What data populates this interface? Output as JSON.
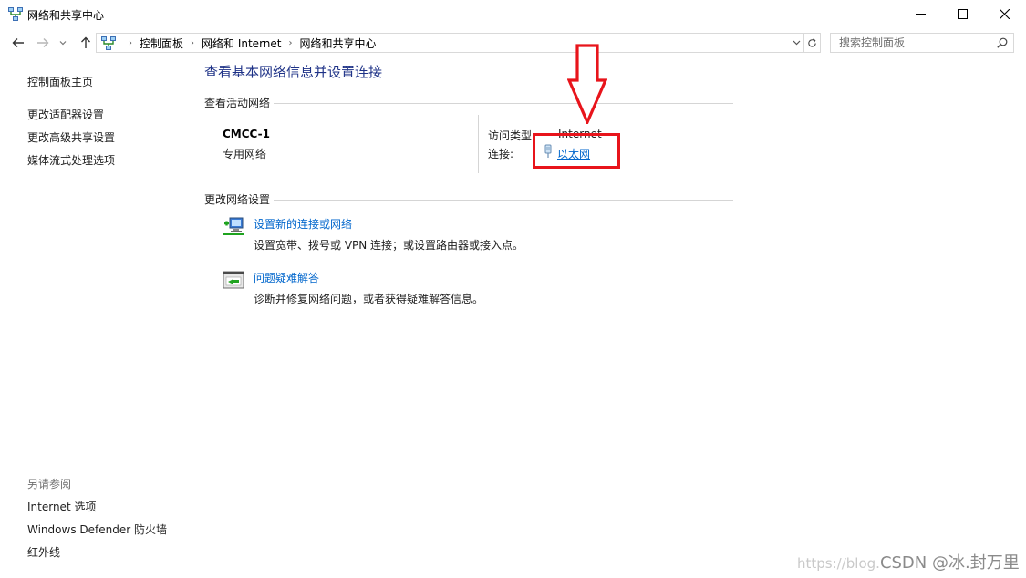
{
  "window": {
    "title": "网络和共享中心",
    "controls": {
      "minimize": "—",
      "maximize": "☐",
      "close": "✕"
    }
  },
  "address_bar": {
    "breadcrumbs": [
      "控制面板",
      "网络和 Internet",
      "网络和共享中心"
    ],
    "search_placeholder": "搜索控制面板"
  },
  "left_pane": {
    "home_link": "控制面板主页",
    "links": [
      "更改适配器设置",
      "更改高级共享设置",
      "媒体流式处理选项"
    ],
    "see_also_title": "另请参阅",
    "see_also_links": [
      "Internet 选项",
      "Windows Defender 防火墙",
      "红外线"
    ]
  },
  "main": {
    "heading": "查看基本网络信息并设置连接",
    "active_networks_title": "查看活动网络",
    "network": {
      "name": "CMCC-1",
      "category": "专用网络",
      "access_type_label": "访问类型:",
      "access_type_value": "Internet",
      "connections_label": "连接:",
      "connection_link": "以太网"
    },
    "change_settings_title": "更改网络设置",
    "tasks": [
      {
        "link": "设置新的连接或网络",
        "description": "设置宽带、拨号或 VPN 连接；或设置路由器或接入点。",
        "icon": "new-connection-icon"
      },
      {
        "link": "问题疑难解答",
        "description": "诊断并修复网络问题，或者获得疑难解答信息。",
        "icon": "troubleshoot-icon"
      }
    ]
  },
  "annotation": {
    "color": "#e8141b"
  },
  "watermark": {
    "faint": "https://blog.",
    "strong": "CSDN @冰.封万里"
  },
  "colors": {
    "link": "#0066cc",
    "heading": "#1e3287"
  }
}
